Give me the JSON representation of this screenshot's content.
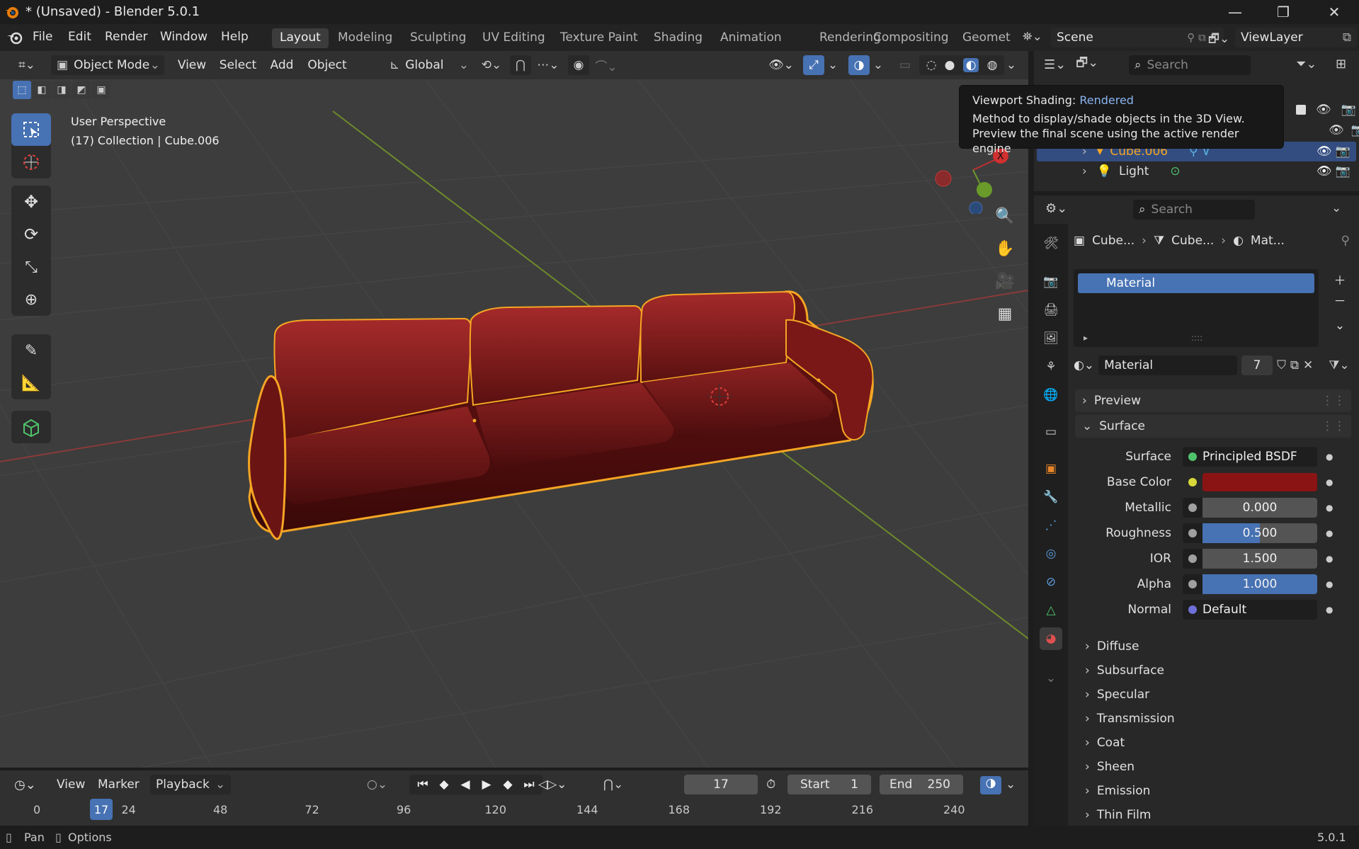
{
  "window": {
    "title": "* (Unsaved) - Blender 5.0.1",
    "minimize": "—",
    "maximize": "❐",
    "close": "✕"
  },
  "menu": [
    "File",
    "Edit",
    "Render",
    "Window",
    "Help"
  ],
  "workspaces": [
    {
      "label": "Layout",
      "active": true
    },
    {
      "label": "Modeling"
    },
    {
      "label": "Sculpting"
    },
    {
      "label": "UV Editing"
    },
    {
      "label": "Texture Paint"
    },
    {
      "label": "Shading"
    },
    {
      "label": "Animation"
    },
    {
      "label": "Rendering"
    },
    {
      "label": "Compositing"
    },
    {
      "label": "Geometr"
    }
  ],
  "scene": {
    "name": "Scene",
    "viewlayer": "ViewLayer"
  },
  "viewport_header": {
    "mode": "Object Mode",
    "view": "View",
    "select": "Select",
    "add": "Add",
    "object": "Object",
    "orientation": "Global"
  },
  "viewport": {
    "perspective": "User Perspective",
    "collection_info": "(17) Collection | Cube.006"
  },
  "tooltip": {
    "prefix": "Viewport Shading: ",
    "value": "Rendered",
    "line1": "Method to display/shade objects in the 3D View.",
    "line2": "Preview the final scene using the active render engine"
  },
  "outliner": {
    "search_placeholder": "Search",
    "items": [
      {
        "label": "Cube.006",
        "selected": true
      },
      {
        "label": "Light",
        "selected": false
      }
    ]
  },
  "properties": {
    "search_placeholder": "Search",
    "breadcrumb": [
      "Cube...",
      "Cube...",
      "Mat..."
    ],
    "material_slot": "Material",
    "material_name": "Material",
    "users": "7",
    "preview_label": "Preview",
    "surface_section": "Surface",
    "fields": [
      {
        "label": "Surface",
        "value": "Principled BSDF",
        "kind": "node",
        "dot": "#4fc36b"
      },
      {
        "label": "Base Color",
        "value": "",
        "kind": "color",
        "dot": "#d8d83a",
        "color": "#8a1414"
      },
      {
        "label": "Metallic",
        "value": "0.000",
        "kind": "slider",
        "dot": "#a0a0a0",
        "fill": 0
      },
      {
        "label": "Roughness",
        "value": "0.500",
        "kind": "slider",
        "dot": "#a0a0a0",
        "fill": 0.5
      },
      {
        "label": "IOR",
        "value": "1.500",
        "kind": "slider",
        "dot": "#a0a0a0",
        "fill": 0
      },
      {
        "label": "Alpha",
        "value": "1.000",
        "kind": "slider",
        "dot": "#a0a0a0",
        "fill": 1
      },
      {
        "label": "Normal",
        "value": "Default",
        "kind": "node",
        "dot": "#6f6fd8"
      }
    ],
    "subsections": [
      "Diffuse",
      "Subsurface",
      "Specular",
      "Transmission",
      "Coat",
      "Sheen",
      "Emission",
      "Thin Film"
    ]
  },
  "timeline": {
    "view": "View",
    "marker": "Marker",
    "playback": "Playback",
    "current_frame": "17",
    "start_label": "Start",
    "start": "1",
    "end_label": "End",
    "end": "250",
    "ruler": [
      "0",
      "24",
      "48",
      "72",
      "96",
      "120",
      "144",
      "168",
      "192",
      "216",
      "240"
    ],
    "ruler_current": "17"
  },
  "status": {
    "pan": "Pan",
    "options": "Options",
    "version": "5.0.1"
  },
  "colors": {
    "accent": "#4772b3",
    "selection": "#f5a623",
    "sofa": "#8b1a1a"
  }
}
